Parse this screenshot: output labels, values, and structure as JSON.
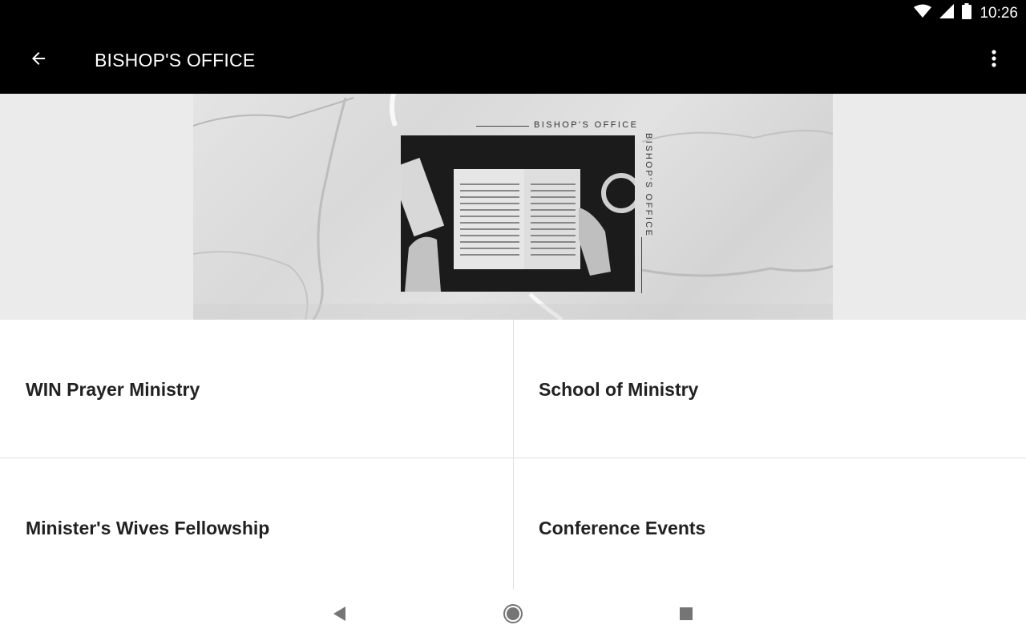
{
  "status_bar": {
    "time": "10:26",
    "icons": [
      "wifi-icon",
      "signal-icon",
      "battery-icon"
    ]
  },
  "app_bar": {
    "title": "BISHOP'S OFFICE",
    "back_icon": "arrow-left-icon",
    "menu_icon": "more-vertical-icon"
  },
  "banner": {
    "caption": "BISHOP'S OFFICE",
    "caption_vertical": "BISHOP'S OFFICE"
  },
  "tiles": [
    {
      "label": "WIN Prayer Ministry"
    },
    {
      "label": "School of Ministry"
    },
    {
      "label": "Minister's Wives Fellowship"
    },
    {
      "label": "Conference Events"
    }
  ],
  "nav_bar": {
    "icons": [
      "back-triangle-icon",
      "home-circle-icon",
      "recents-square-icon"
    ]
  },
  "colors": {
    "app_bar": "#000000",
    "text_primary": "#212121",
    "divider": "#e0e0e0",
    "banner_bg": "#ebebeb"
  }
}
